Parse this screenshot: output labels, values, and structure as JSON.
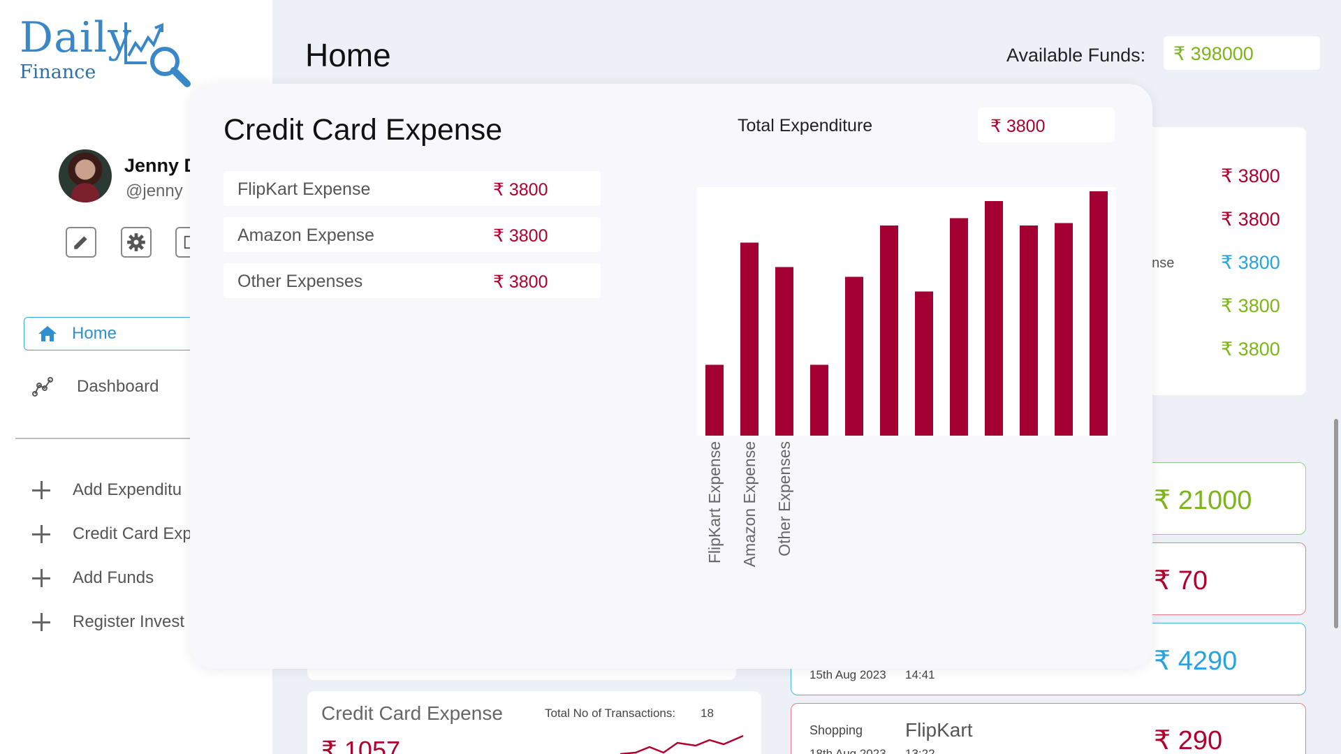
{
  "app": {
    "logo_main": "Daily",
    "logo_sub": "Finance"
  },
  "user": {
    "name": "Jenny D",
    "handle": "@jenny"
  },
  "nav": {
    "home": "Home",
    "dashboard": "Dashboard",
    "actions": [
      "Add Expenditu",
      "Credit Card Exp",
      "Add Funds",
      "Register Invest"
    ]
  },
  "header": {
    "title": "Home",
    "funds_label": "Available Funds:",
    "funds_value": "₹ 398000"
  },
  "right_card": {
    "fragments": [
      "e",
      ":",
      "ense"
    ],
    "values": [
      "₹ 3800",
      "₹ 3800",
      "₹ 3800",
      "₹ 3800",
      "₹ 3800"
    ],
    "colors": [
      "#b0002e",
      "#b0002e",
      "#29a3e0",
      "#7cb518",
      "#7cb518"
    ]
  },
  "transactions": [
    {
      "amount": "₹ 21000",
      "color": "#7cb518",
      "border": "#8fd08a"
    },
    {
      "amount": "₹ 70",
      "color": "#b0002e",
      "border": "#ee7a86"
    },
    {
      "amount": "₹ 4290",
      "color": "#29a3e0",
      "border": "#49b6ea",
      "date": "15th Aug 2023",
      "time": "14:41"
    },
    {
      "amount": "₹ 290",
      "color": "#b0002e",
      "border": "#ee7a86",
      "category": "Shopping",
      "merchant": "FlipKart",
      "date": "18th Aug 2023",
      "time": "13:22"
    }
  ],
  "bottom_card": {
    "title": "Credit Card Expense",
    "tx_label": "Total No of Transactions:",
    "tx_count": "18",
    "value": "₹ 1057"
  },
  "popup": {
    "title": "Credit Card Expense",
    "total_label": "Total Expenditure",
    "total_value": "₹ 3800",
    "rows": [
      {
        "name": "FlipKart Expense",
        "value": "₹ 3800"
      },
      {
        "name": "Amazon Expense",
        "value": "₹ 3800"
      },
      {
        "name": "Other Expenses",
        "value": "₹ 3800"
      }
    ]
  },
  "chart_data": {
    "type": "bar",
    "categories": [
      "FlipKart Expense",
      "Amazon Expense",
      "Other Expenses",
      "",
      "",
      "",
      "",
      "",
      "",
      "",
      "",
      ""
    ],
    "values": [
      0.29,
      0.79,
      0.69,
      0.29,
      0.65,
      0.86,
      0.59,
      0.89,
      0.96,
      0.86,
      0.87,
      1.0
    ],
    "bar_color": "#a50034",
    "ylim": [
      0,
      1
    ],
    "grid": false
  }
}
